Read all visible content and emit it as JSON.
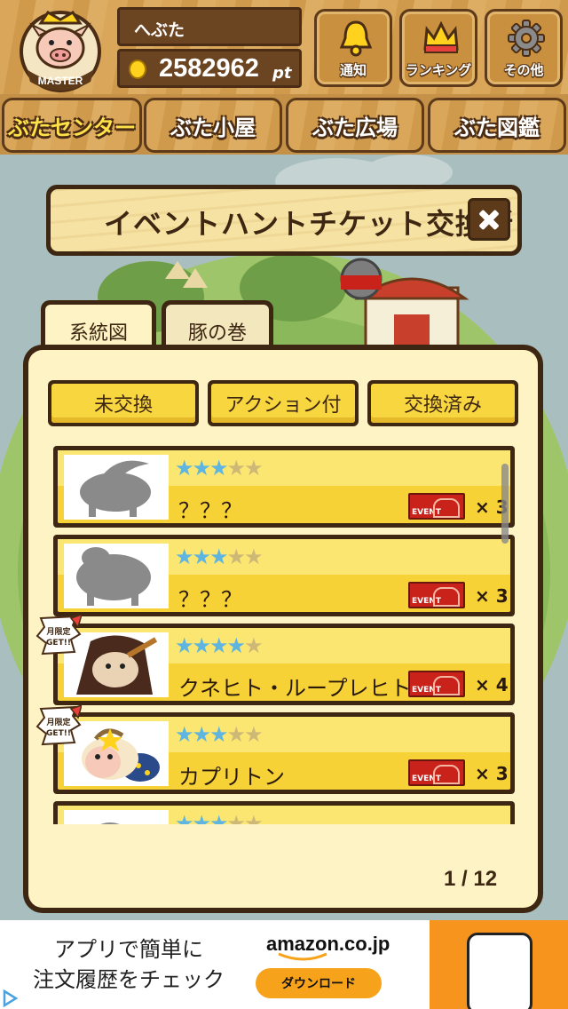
{
  "header": {
    "avatar_label": "MASTER",
    "user_name": "へぶた",
    "points": "2582962",
    "points_unit": "pt",
    "buttons": [
      {
        "label": "通知",
        "icon": "bell-icon"
      },
      {
        "label": "ランキング",
        "icon": "crown-icon"
      },
      {
        "label": "その他",
        "icon": "gear-icon"
      }
    ]
  },
  "nav": {
    "tabs": [
      {
        "label": "ぶたセンター",
        "active": true
      },
      {
        "label": "ぶた小屋",
        "active": false
      },
      {
        "label": "ぶた広場",
        "active": false
      },
      {
        "label": "ぶた図鑑",
        "active": false
      }
    ]
  },
  "dialog": {
    "title": "イベントハントチケット交換所",
    "tabs": [
      {
        "label": "系統図",
        "active": true
      },
      {
        "label": "豚の巻",
        "active": false
      }
    ],
    "filters": [
      "未交換",
      "アクション付",
      "交換済み"
    ],
    "items": [
      {
        "name": "？？？",
        "stars": 3,
        "max_stars": 5,
        "event_label": "EVENT",
        "qty": "× 3",
        "limited": false,
        "silhouette": true
      },
      {
        "name": "？？？",
        "stars": 3,
        "max_stars": 5,
        "event_label": "EVENT",
        "qty": "× 3",
        "limited": false,
        "silhouette": true
      },
      {
        "name": "クネヒト・ループレヒト",
        "stars": 4,
        "max_stars": 5,
        "event_label": "EVENT",
        "qty": "× 4",
        "limited": true,
        "silhouette": false
      },
      {
        "name": "カプリトン",
        "stars": 3,
        "max_stars": 5,
        "event_label": "EVENT",
        "qty": "× 3",
        "limited": true,
        "silhouette": false
      },
      {
        "name": "",
        "stars": 3,
        "max_stars": 5,
        "event_label": "",
        "qty": "",
        "limited": false,
        "silhouette": true
      }
    ],
    "limited_badge": "月限定 GET!!",
    "page_indicator": "1 / 12"
  },
  "ad": {
    "text_line1": "アプリで簡単に",
    "text_line2": "注文履歴をチェック",
    "brand": "amazon.co.jp",
    "button_label": "ダウンロード"
  },
  "colors": {
    "wood": "#d9a65a",
    "dark_brown": "#3e2712",
    "row_yellow": "#f7d236",
    "star_on": "#5db5e0",
    "event_red": "#c8221a"
  }
}
